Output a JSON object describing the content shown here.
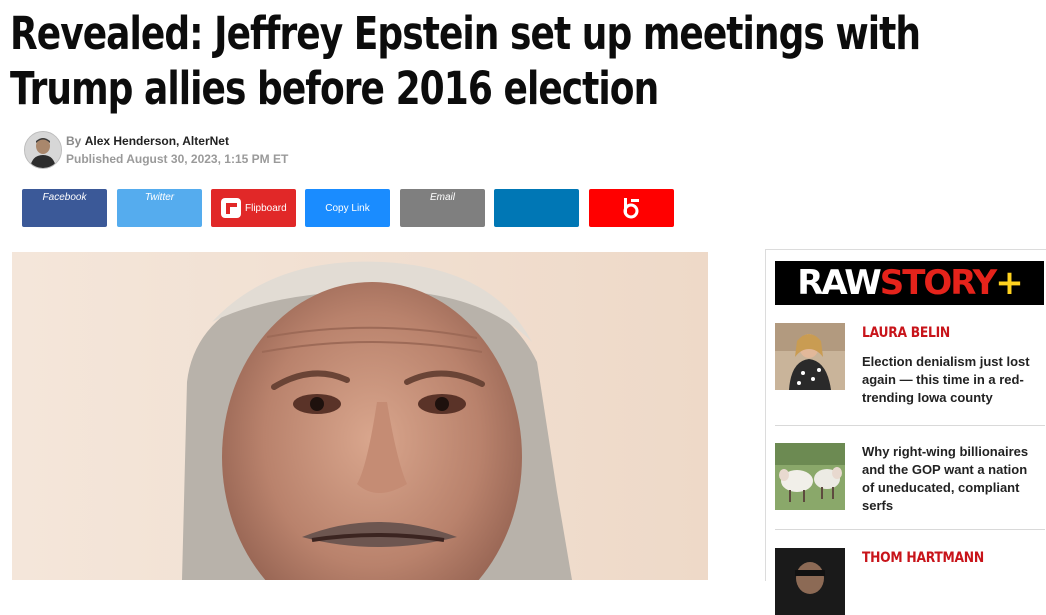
{
  "article": {
    "headline": "Revealed: Jeffrey Epstein set up meetings with Trump allies before 2016 election",
    "by_prefix": "By",
    "author": "Alex Henderson, AlterNet",
    "published": "Published August 30, 2023, 1:15 PM ET"
  },
  "share": {
    "facebook": "Facebook",
    "twitter": "Twitter",
    "flipboard": "Flipboard",
    "copy_link": "Copy Link",
    "email": "Email",
    "colors": {
      "facebook": "#3b5998",
      "twitter": "#55acee",
      "flipboard": "#e12828",
      "copy_link": "#1a8cff",
      "email": "#7f7f7f",
      "linkedin": "#0077b5",
      "beehiiv": "#ff0000"
    },
    "icons": [
      "flipboard-icon",
      "beehiiv-icon"
    ]
  },
  "sidebar": {
    "brand": {
      "part1": "RAW",
      "part2": "STORY",
      "part3": "+"
    },
    "stories": [
      {
        "author": "LAURA BELIN",
        "title": "Election denialism just lost again — this time in a red-trending Iowa county"
      },
      {
        "author": "",
        "title": "Why right-wing billionaires and the GOP want a nation of uneducated, compliant serfs"
      },
      {
        "author": "THOM HARTMANN",
        "title": ""
      }
    ]
  }
}
